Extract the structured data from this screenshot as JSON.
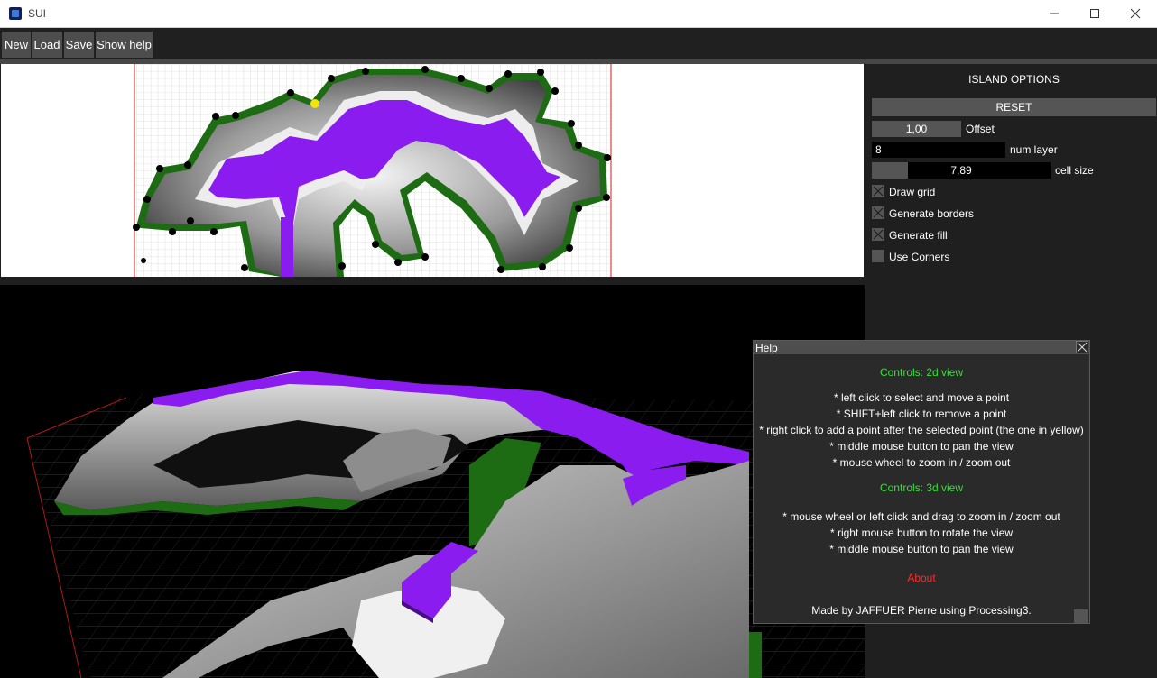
{
  "window": {
    "title": "SUI"
  },
  "menu": {
    "new": "New",
    "load": "Load",
    "save": "Save",
    "show_help": "Show help"
  },
  "panel": {
    "title": "ISLAND OPTIONS",
    "reset": "RESET",
    "offset": {
      "value": "1,00",
      "label": "Offset"
    },
    "num_layer": {
      "value": "8",
      "label": "num layer"
    },
    "cell_size": {
      "value": "7,89",
      "label": "cell size",
      "slider_fraction": 0.2
    },
    "checkboxes": [
      {
        "label": "Draw grid",
        "checked": true
      },
      {
        "label": "Generate borders",
        "checked": true
      },
      {
        "label": "Generate fill",
        "checked": true
      },
      {
        "label": "Use Corners",
        "checked": false
      }
    ]
  },
  "help": {
    "title": "Help",
    "controls_2d_title": "Controls: 2d view",
    "controls_2d": [
      "* left click to select and move a point",
      "* SHIFT+left click to remove a point",
      "* right click to add a point after the selected point (the one in yellow)",
      "* middle mouse button to pan the view",
      "* mouse wheel to zoom in / zoom out"
    ],
    "controls_3d_title": "Controls: 3d view",
    "controls_3d": [
      "* mouse wheel or left click and drag to zoom in / zoom out",
      "* right mouse button to rotate the view",
      "* middle mouse button to pan the view"
    ],
    "about_title": "About",
    "about_text": "Made by JAFFUER Pierre using Processing3."
  },
  "colors": {
    "fill": "#8a1cf0",
    "border": "#1d6b12",
    "selected_point": "#f2e30b"
  }
}
